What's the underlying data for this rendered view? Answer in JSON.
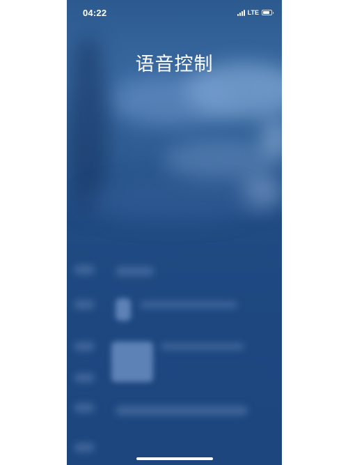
{
  "status_bar": {
    "time": "04:22",
    "network": "LTE",
    "battery_level": 0.85,
    "icons": [
      "signal-bars-icon",
      "battery-icon"
    ]
  },
  "page": {
    "title": "语音控制"
  },
  "colors": {
    "background_top": "#2c5a8f",
    "background_bottom": "#1d457e",
    "text": "#ffffff"
  }
}
